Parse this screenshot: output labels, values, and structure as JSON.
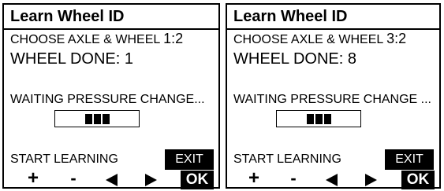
{
  "panels": [
    {
      "title": "Learn Wheel ID",
      "choose_label": "CHOOSE AXLE & WHEEL ",
      "choose_value": "1:2",
      "done_label": "WHEEL DONE: ",
      "done_value": "1",
      "waiting_text": "WAITING PRESSURE CHANGE...",
      "progress_segments": 3,
      "start_label": "START LEARNING",
      "exit_label": "EXIT",
      "plus_label": "+",
      "minus_label": "-",
      "ok_label": "OK"
    },
    {
      "title": "Learn Wheel ID",
      "choose_label": "CHOOSE AXLE & WHEEL ",
      "choose_value": "3:2",
      "done_label": "WHEEL DONE: ",
      "done_value": "8",
      "waiting_text": "WAITING PRESSURE CHANGE ...",
      "progress_segments": 3,
      "start_label": "START LEARNING",
      "exit_label": "EXIT",
      "plus_label": "+",
      "minus_label": "-",
      "ok_label": "OK"
    }
  ],
  "icons": {
    "left": "left-arrow-icon",
    "right": "right-arrow-icon"
  },
  "colors": {
    "foreground": "#000000",
    "background": "#ffffff"
  }
}
